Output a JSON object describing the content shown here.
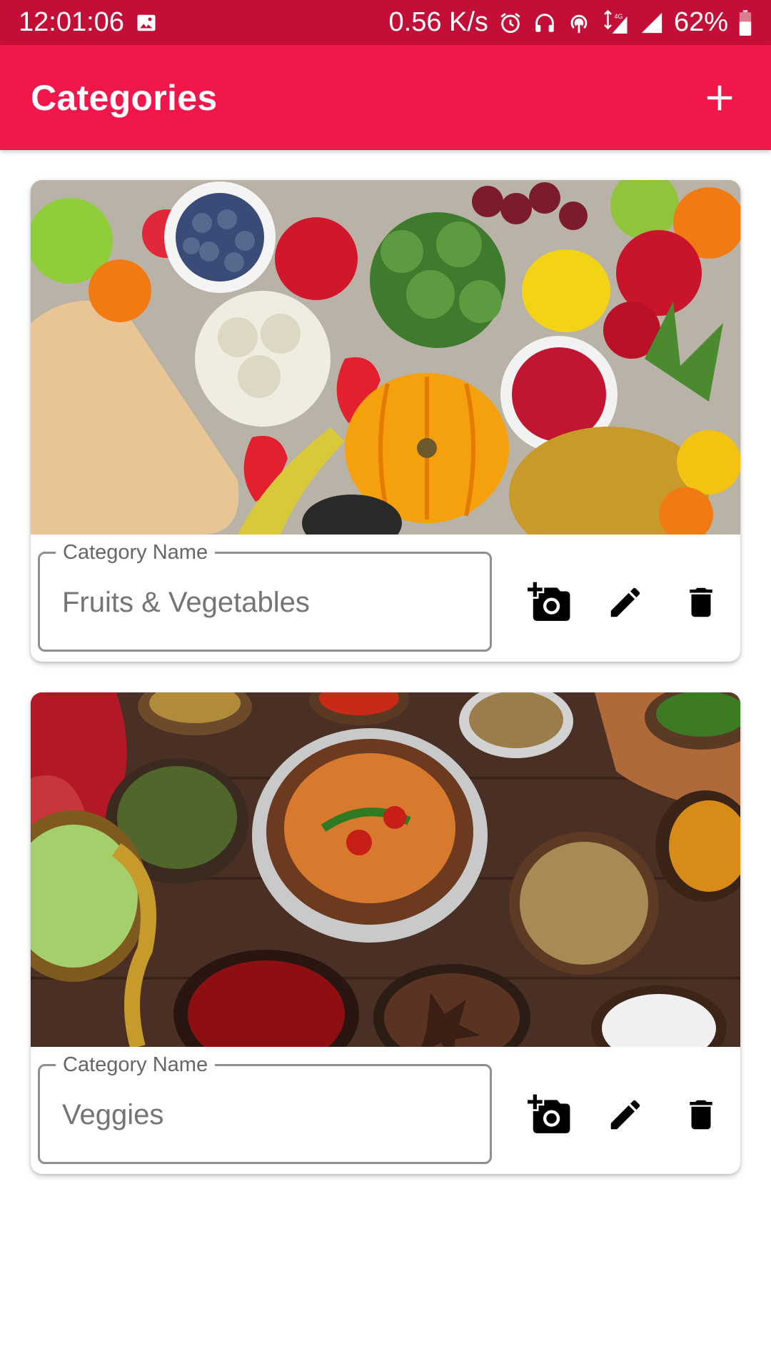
{
  "status_bar": {
    "time": "12:01:06",
    "network_speed": "0.56 K/s",
    "network_type": "4G",
    "battery": "62%",
    "icons": [
      "image-icon",
      "alarm-icon",
      "headset-icon",
      "hotspot-icon",
      "data-arrows-icon",
      "signal-icon",
      "signal-icon",
      "battery-icon"
    ]
  },
  "app_bar": {
    "title": "Categories",
    "add_icon": "plus-icon"
  },
  "colors": {
    "status_bar": "#c30f37",
    "app_bar": "#f2174a",
    "icon": "#000000"
  },
  "categories": [
    {
      "field_label": "Category Name",
      "name": "Fruits & Vegetables",
      "image_description_icon": "fruits-vegetables-photo",
      "actions": [
        "add-photo-icon",
        "edit-icon",
        "delete-icon"
      ]
    },
    {
      "field_label": "Category Name",
      "name": "Veggies",
      "image_description_icon": "spices-curry-photo",
      "actions": [
        "add-photo-icon",
        "edit-icon",
        "delete-icon"
      ]
    }
  ]
}
